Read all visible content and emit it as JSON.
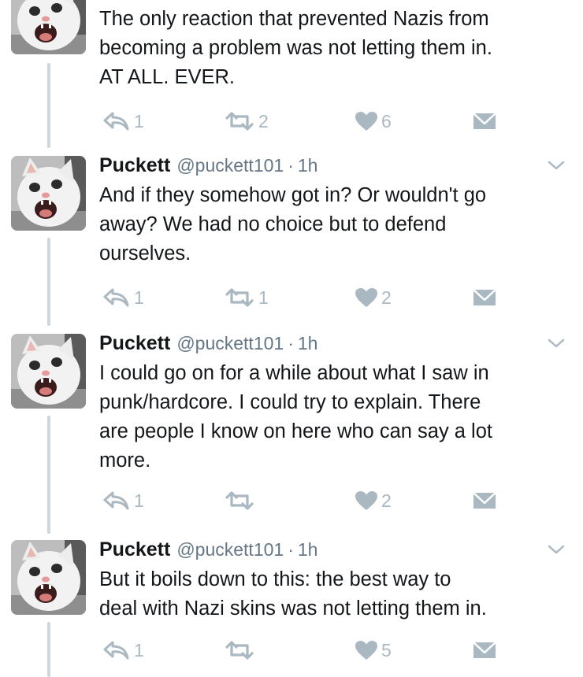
{
  "colors": {
    "text": "#14171a",
    "muted": "#657786",
    "icon": "#aab8c2",
    "thread": "#ccd6dd"
  },
  "tweets": [
    {
      "name": "",
      "handle": "",
      "dot": "",
      "time": "",
      "lines": [
        "The only reaction that prevented Nazis from",
        "becoming a problem was not letting them in.",
        "AT ALL. EVER."
      ],
      "reply_count": "1",
      "retweet_count": "2",
      "like_count": "6"
    },
    {
      "name": "Puckett",
      "handle": "@puckett101",
      "dot": "·",
      "time": "1h",
      "lines": [
        "And if they somehow got in? Or wouldn't go",
        "away? We had no choice but to defend",
        "ourselves."
      ],
      "reply_count": "1",
      "retweet_count": "1",
      "like_count": "2"
    },
    {
      "name": "Puckett",
      "handle": "@puckett101",
      "dot": "·",
      "time": "1h",
      "lines": [
        "I could go on for a while about what I saw in",
        "punk/hardcore. I could try to explain. There",
        "are people I know on here who can say a lot",
        "more."
      ],
      "reply_count": "1",
      "retweet_count": "",
      "like_count": "2"
    },
    {
      "name": "Puckett",
      "handle": "@puckett101",
      "dot": "·",
      "time": "1h",
      "lines": [
        "But it boils down to this: the best way to",
        "deal with Nazi skins was not letting them in."
      ],
      "reply_count": "1",
      "retweet_count": "",
      "like_count": "5"
    }
  ]
}
